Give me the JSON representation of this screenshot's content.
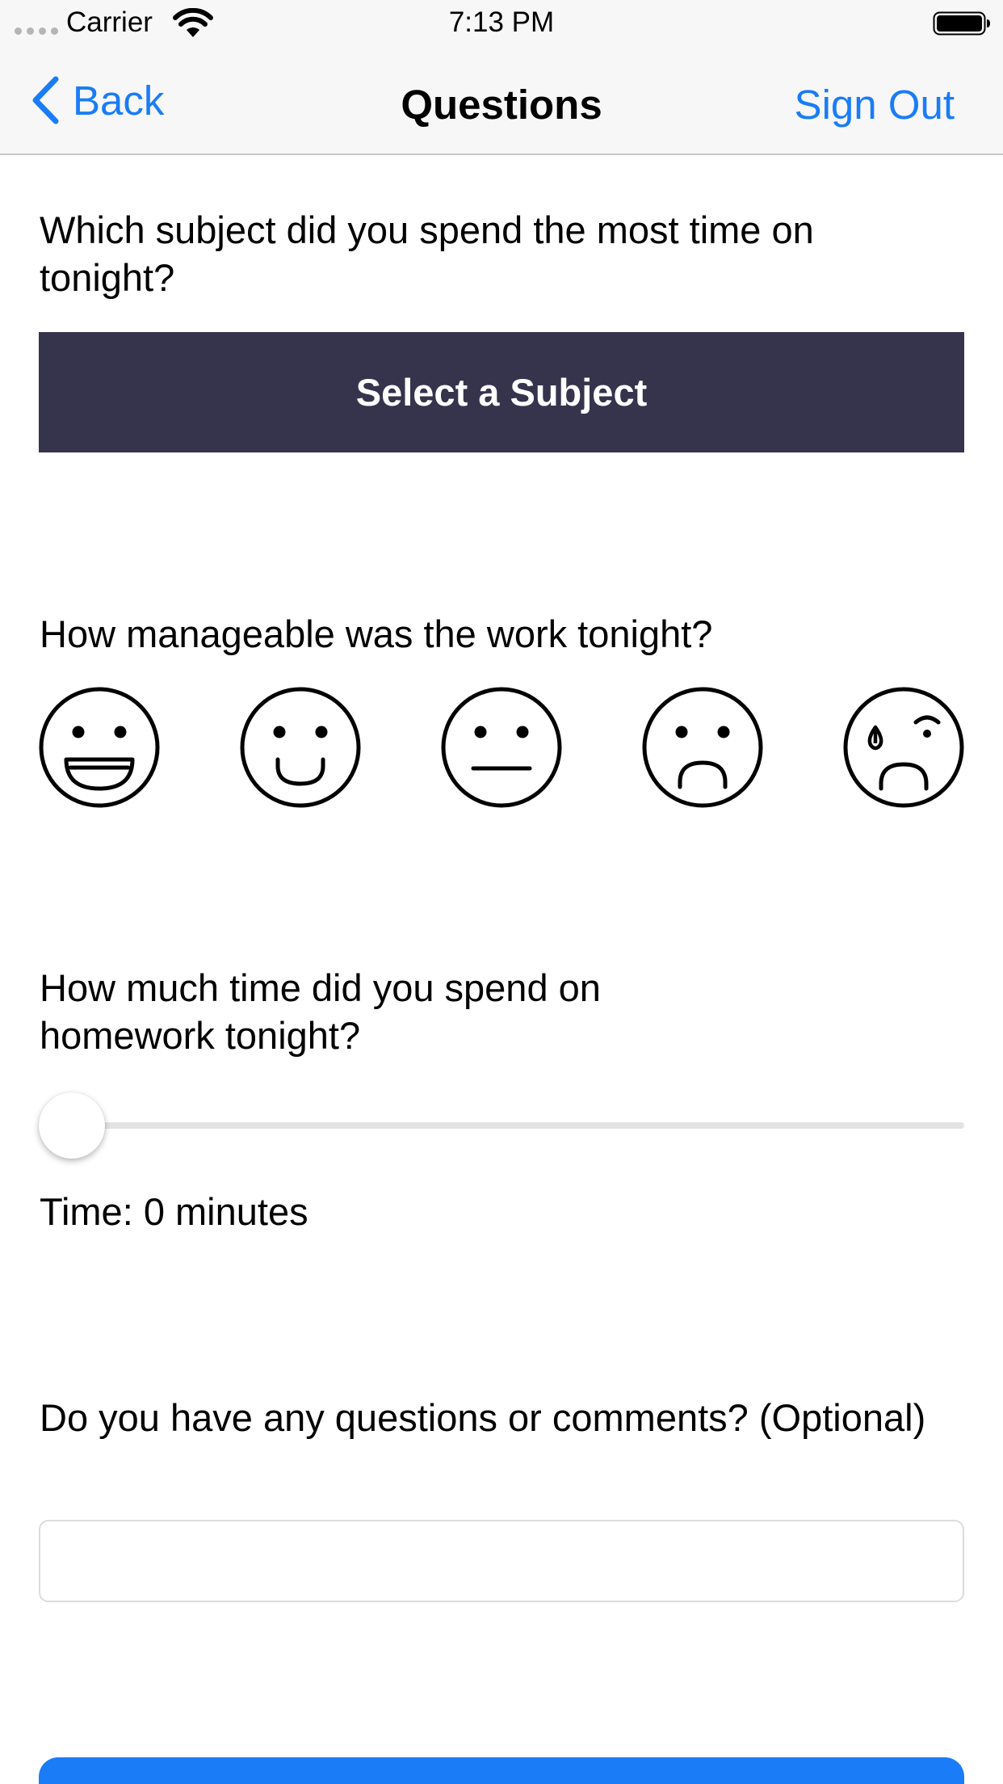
{
  "status_bar": {
    "carrier": "Carrier",
    "time": "7:13 PM"
  },
  "nav": {
    "back_label": "Back",
    "title": "Questions",
    "sign_out_label": "Sign Out"
  },
  "q_subject": {
    "prompt": "Which subject did you spend the most time on tonight?",
    "button_label": "Select a Subject"
  },
  "q_manageable": {
    "prompt": "How manageable was the work tonight?",
    "faces": [
      "grinning-face-icon",
      "smiling-face-icon",
      "neutral-face-icon",
      "frowning-face-icon",
      "crying-face-icon"
    ]
  },
  "q_time": {
    "prompt": "How much time did you spend on homework tonight?",
    "slider_value": 0,
    "time_text": "Time: 0 minutes"
  },
  "q_comments": {
    "prompt": "Do you have any questions or comments? (Optional)",
    "value": "",
    "placeholder": ""
  },
  "colors": {
    "accent": "#1a7cf7",
    "subject_button": "#36334d",
    "bar_background": "#f7f7f7"
  }
}
